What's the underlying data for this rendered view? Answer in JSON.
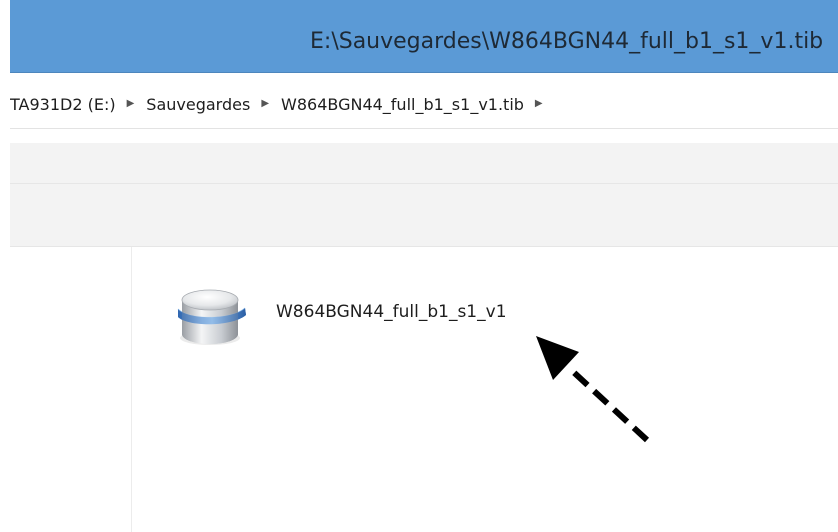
{
  "window": {
    "title": "E:\\Sauvegardes\\W864BGN44_full_b1_s1_v1.tib",
    "accent_color": "#5b9ad6"
  },
  "address_bar": {
    "breadcrumb": [
      "TA931D2 (E:)",
      "Sauvegardes",
      "W864BGN44_full_b1_s1_v1.tib"
    ],
    "separator_icon": "chevron-right-icon"
  },
  "content": {
    "items": [
      {
        "name": "W864BGN44_full_b1_s1_v1",
        "icon": "backup-disk-icon"
      }
    ]
  },
  "annotation": {
    "icon": "dashed-arrow-icon",
    "color": "#000000"
  }
}
